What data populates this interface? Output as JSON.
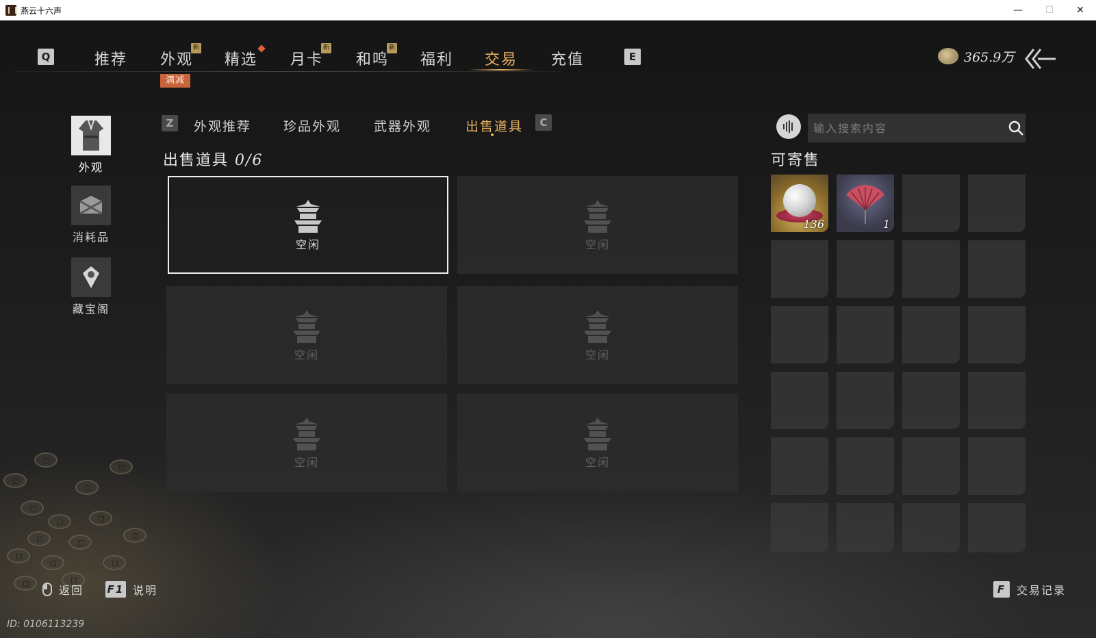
{
  "window": {
    "title": "燕云十六声",
    "min": "—",
    "max": "☐",
    "close": "✕"
  },
  "topnav": {
    "key_left": "Q",
    "key_right": "E",
    "tabs": [
      {
        "label": "推荐"
      },
      {
        "label": "外观",
        "badge": "新"
      },
      {
        "label": "精选"
      },
      {
        "label": "月卡",
        "badge": "新"
      },
      {
        "label": "和鸣",
        "badge": "新"
      },
      {
        "label": "福利"
      },
      {
        "label": "交易"
      },
      {
        "label": "充值"
      }
    ],
    "active_tab": "交易",
    "promo_tag": "满减",
    "currency": "365.9万"
  },
  "sidebar": {
    "items": [
      {
        "label": "外观"
      },
      {
        "label": "消耗品"
      },
      {
        "label": "藏宝阁"
      }
    ]
  },
  "subnav": {
    "key_left": "Z",
    "key_right": "C",
    "tabs": [
      {
        "label": "外观推荐"
      },
      {
        "label": "珍品外观"
      },
      {
        "label": "武器外观"
      },
      {
        "label": "出售道具"
      }
    ],
    "active_tab": "出售道具"
  },
  "sell": {
    "title": "出售道具",
    "count": "0/6",
    "slots": [
      {
        "label": "空闲"
      },
      {
        "label": "空闲"
      },
      {
        "label": "空闲"
      },
      {
        "label": "空闲"
      },
      {
        "label": "空闲"
      },
      {
        "label": "空闲"
      }
    ]
  },
  "search": {
    "placeholder": "输入搜索内容"
  },
  "inventory": {
    "title": "可寄售",
    "items": [
      {
        "name": "pearl",
        "qty": "136"
      },
      {
        "name": "fan",
        "qty": "1"
      }
    ]
  },
  "bottom": {
    "back_label": "返回",
    "help_key": "F1",
    "help_label": "说明",
    "record_key": "F",
    "record_label": "交易记录",
    "player_id": "ID: 0106113239"
  },
  "colors": {
    "accent": "#e8b060",
    "promo": "#c8643a",
    "badge": "#b79a5a"
  }
}
